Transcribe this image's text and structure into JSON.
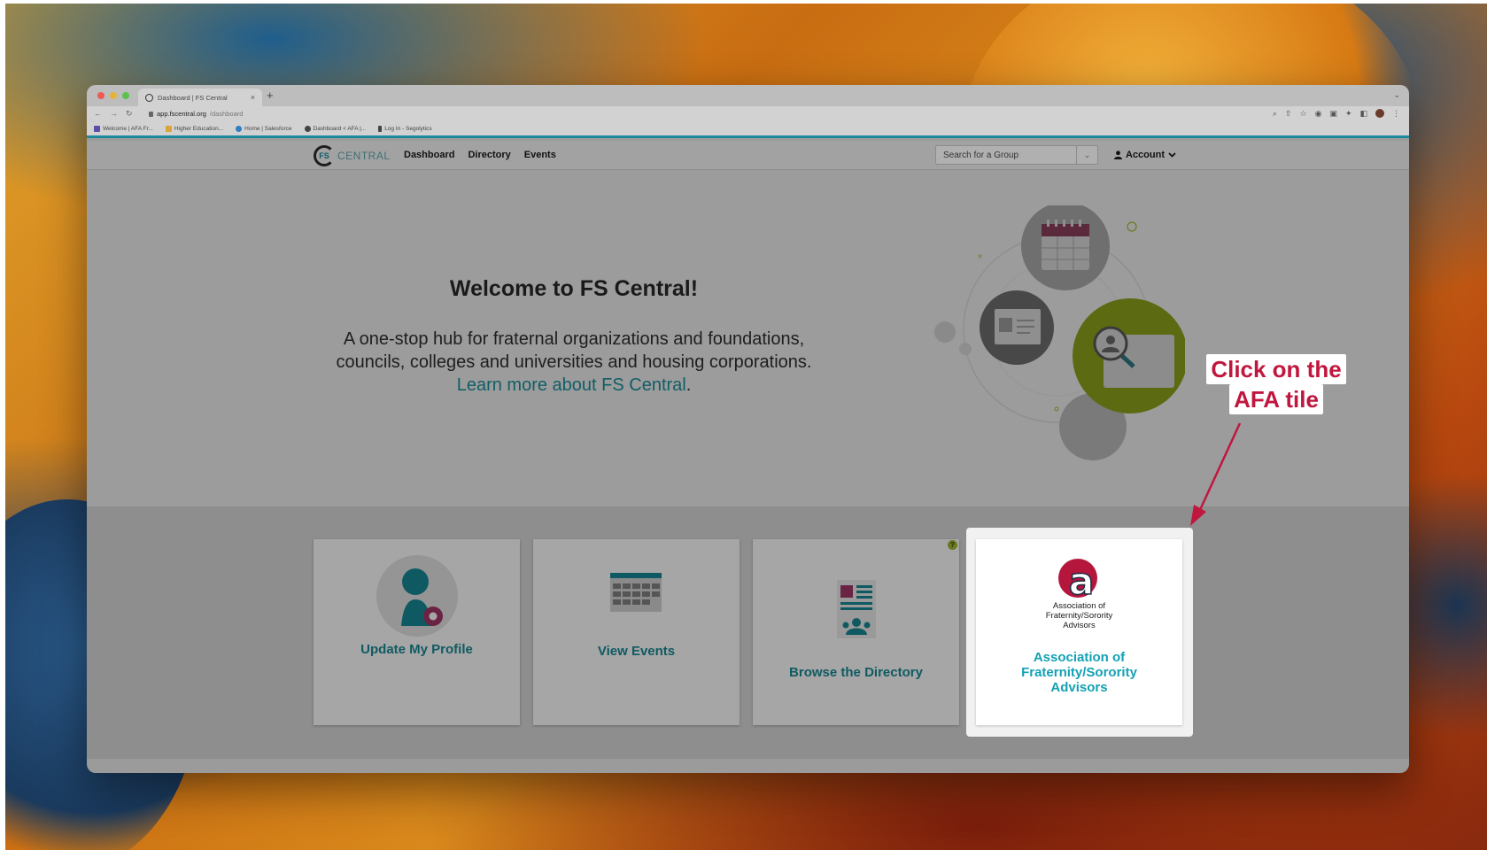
{
  "browser": {
    "tab_title": "Dashboard | FS Central",
    "tab_close": "×",
    "new_tab": "+",
    "url_host": "app.fscentral.org",
    "url_path": "/dashboard",
    "bookmarks": [
      "Welcome | AFA Fr...",
      "Higher Education...",
      "Home | Salesforce",
      "Dashboard < AFA |...",
      "Log In - Segolytics"
    ]
  },
  "site": {
    "logo_mark": "FS",
    "logo_word": "CENTRAL",
    "nav": [
      "Dashboard",
      "Directory",
      "Events"
    ],
    "search_placeholder": "Search for a Group",
    "account_label": "Account"
  },
  "hero": {
    "title": "Welcome to FS Central!",
    "line1": "A one-stop hub for fraternal organizations and foundations,",
    "line2": "councils, colleges and universities and housing corporations.",
    "learn_link": "Learn more about FS Central",
    "learn_suffix": "."
  },
  "tiles": {
    "profile": "Update My Profile",
    "events": "View Events",
    "directory": "Browse the Directory",
    "help": "?",
    "afa_logo_line1": "Association of",
    "afa_logo_line2": "Fraternity/Sorority",
    "afa_logo_line3": "Advisors",
    "afa_label_line1": "Association of",
    "afa_label_line2": "Fraternity/Sorority",
    "afa_label_line3": "Advisors"
  },
  "annotation": {
    "line1": "Click on the",
    "line2": "AFA tile",
    "color": "#c0173e"
  },
  "colors": {
    "accent": "#1c8a9c",
    "tile_label": "#13a1b4"
  }
}
